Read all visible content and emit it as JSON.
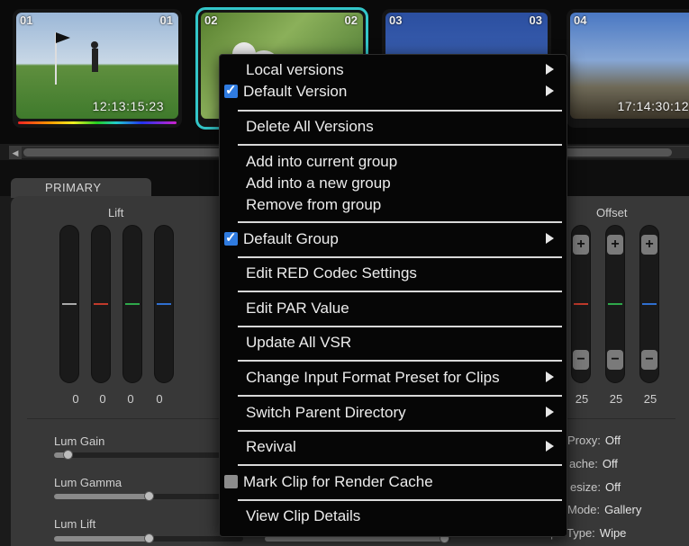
{
  "clips": [
    {
      "num": "01",
      "track": "01",
      "timecode": "12:13:15:23"
    },
    {
      "num": "02",
      "track": "02",
      "timecode": ""
    },
    {
      "num": "03",
      "track": "03",
      "timecode": ""
    },
    {
      "num": "04",
      "track": "",
      "timecode": "17:14:30:12"
    }
  ],
  "panel": {
    "tab": "PRIMARY",
    "lift": {
      "title": "Lift",
      "values": [
        "0",
        "0",
        "0",
        "0"
      ]
    },
    "offset": {
      "title": "Offset",
      "values": [
        "25",
        "25",
        "25"
      ]
    },
    "sliders": [
      {
        "label": "Lum Gain",
        "value": 0.05
      },
      {
        "label": "Lum Gamma",
        "value": 0.5
      },
      {
        "label": "Lum Lift",
        "value": 0.5
      }
    ],
    "info": [
      {
        "label": "Proxy:",
        "value": "Off"
      },
      {
        "label": "ache:",
        "value": "Off"
      },
      {
        "label": "esize:",
        "value": "Off"
      },
      {
        "label": "Mode:",
        "value": "Gallery"
      },
      {
        "label": "Wipe Type:",
        "value": "Wipe"
      }
    ]
  },
  "menu": {
    "local_versions": "Local versions",
    "default_version": "Default Version",
    "delete_all_versions": "Delete All Versions",
    "add_current_group": "Add into current group",
    "add_new_group": "Add into a new group",
    "remove_group": "Remove from group",
    "default_group": "Default Group",
    "edit_red": "Edit RED Codec Settings",
    "edit_par": "Edit PAR Value",
    "update_vsr": "Update All VSR",
    "change_input": "Change Input Format Preset for Clips",
    "switch_parent": "Switch Parent Directory",
    "revival": "Revival",
    "mark_clip": "Mark Clip for Render Cache",
    "view_details": "View Clip Details"
  },
  "colors": {
    "accent": "#33c6c9",
    "checkbox": "#2f7be0",
    "red": "#c0392b",
    "green": "#2ea84a",
    "blue": "#2f6fd0"
  }
}
